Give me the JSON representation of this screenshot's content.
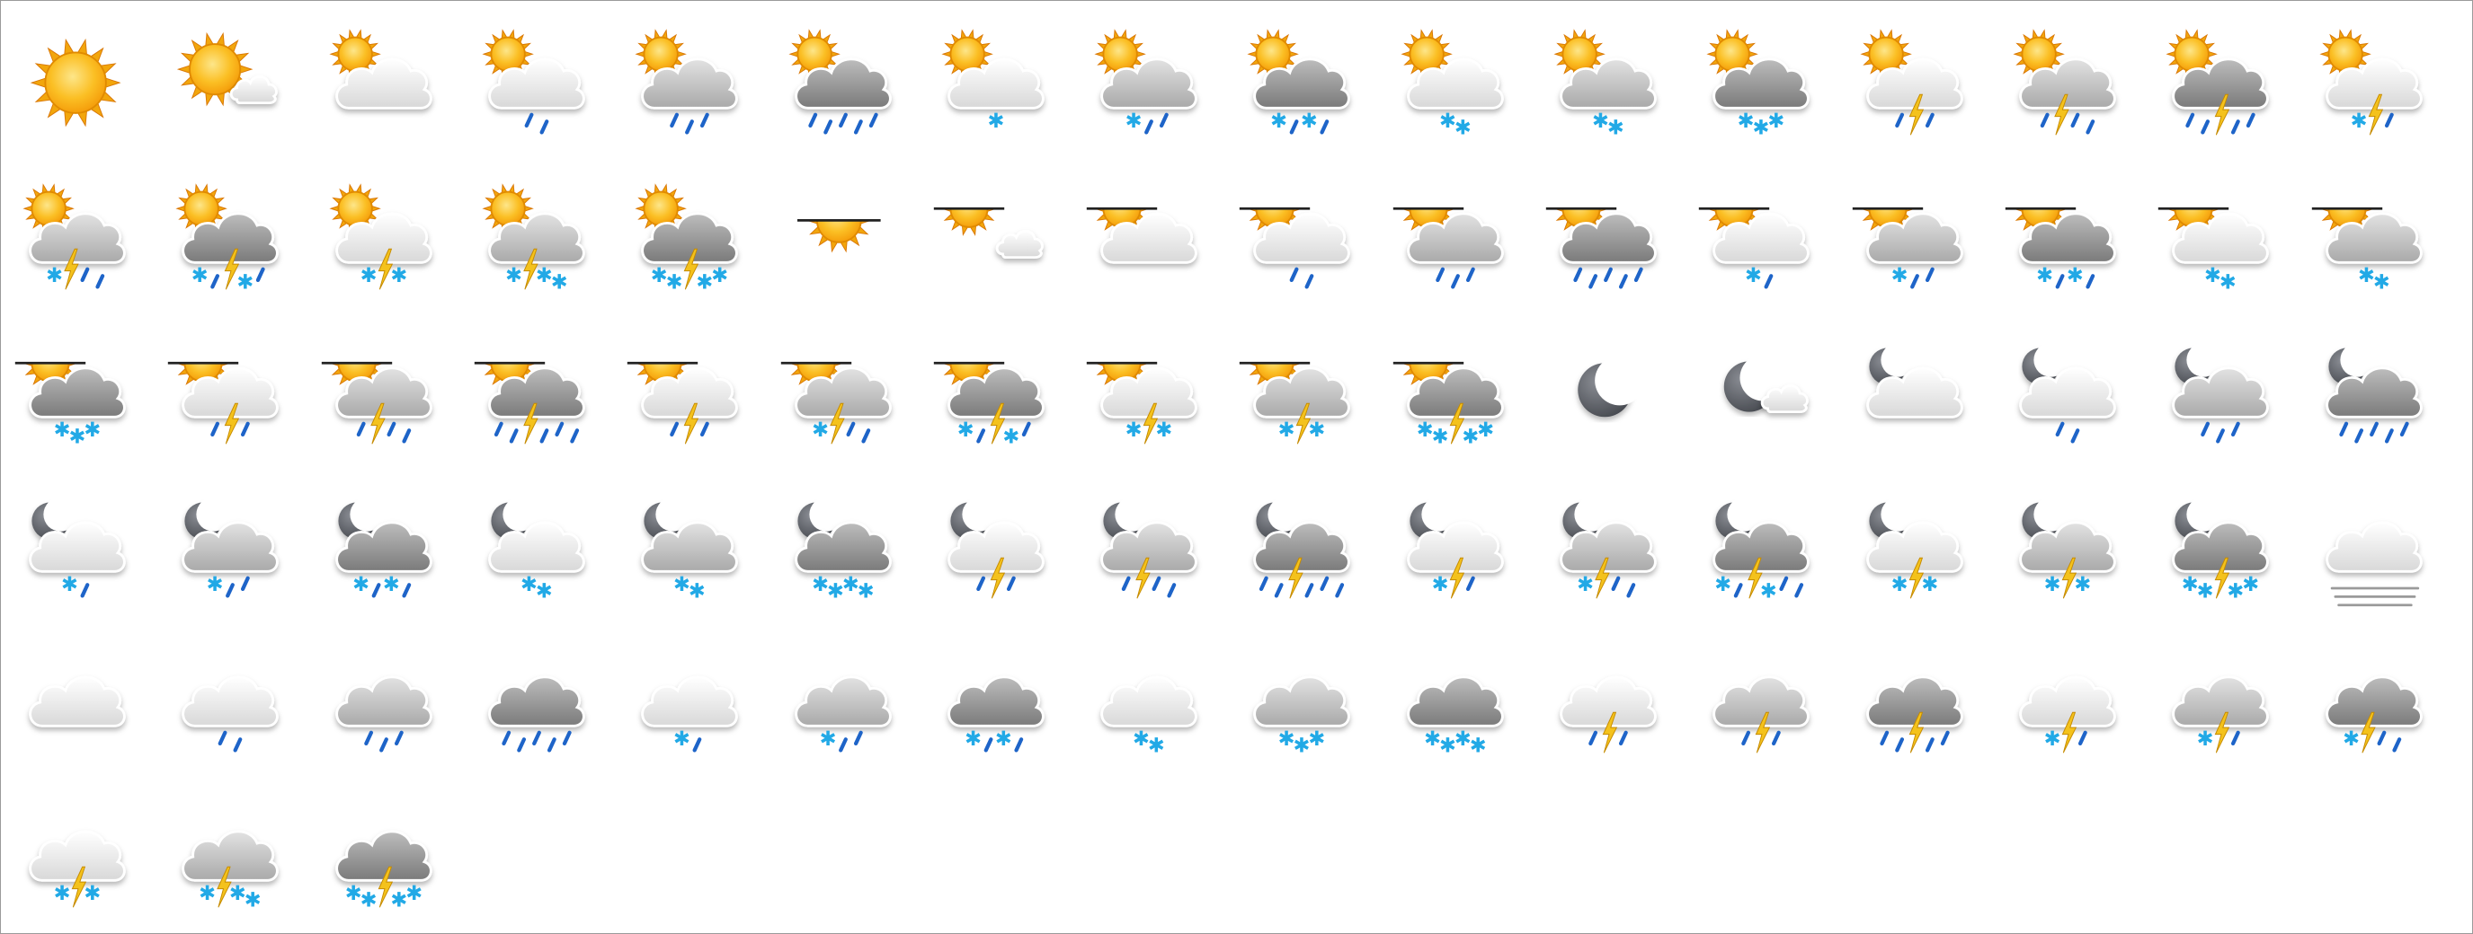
{
  "colors": {
    "sun_outer": "#f2a60c",
    "sun_inner": "#fcd34d",
    "moon": "#5e6168",
    "cloud_light": "#f3f3f3",
    "cloud_mid": "#cfcfcf",
    "cloud_dark": "#9c9c9c",
    "rain": "#1e64c8",
    "snow": "#22a9e6",
    "lightning": "#f4c21c",
    "horizon": "#222222",
    "fog": "#9a9a9a"
  },
  "icons": [
    {
      "name": "clear-sun-icon",
      "sky": "sun"
    },
    {
      "name": "sun-light-cloud-icon",
      "sky": "sun",
      "cloud": "small"
    },
    {
      "name": "sun-cloudy-icon",
      "sky": "sun",
      "cloud": "light"
    },
    {
      "name": "sun-light-rain-icon",
      "sky": "sun",
      "cloud": "light",
      "rain": 2
    },
    {
      "name": "sun-rain-icon",
      "sky": "sun",
      "cloud": "mid",
      "rain": 3
    },
    {
      "name": "sun-heavy-rain-icon",
      "sky": "sun",
      "cloud": "dark",
      "rain": 5
    },
    {
      "name": "sun-light-sleet-icon",
      "sky": "sun",
      "cloud": "light",
      "snow": 1
    },
    {
      "name": "sun-sleet-icon",
      "sky": "sun",
      "cloud": "mid",
      "snow": 1,
      "rain": 2
    },
    {
      "name": "sun-heavy-sleet-icon",
      "sky": "sun",
      "cloud": "dark",
      "snow": 2,
      "rain": 2
    },
    {
      "name": "sun-light-snow-icon",
      "sky": "sun",
      "cloud": "light",
      "snow": 2
    },
    {
      "name": "sun-snow-icon",
      "sky": "sun",
      "cloud": "mid",
      "snow": 2
    },
    {
      "name": "sun-heavy-snow-icon",
      "sky": "sun",
      "cloud": "dark",
      "snow": 3
    },
    {
      "name": "sun-light-rain-thunder-icon",
      "sky": "sun",
      "cloud": "light",
      "rain": 2,
      "bolt": true
    },
    {
      "name": "sun-rain-thunder-icon",
      "sky": "sun",
      "cloud": "mid",
      "rain": 3,
      "bolt": true
    },
    {
      "name": "sun-heavy-rain-thunder-icon",
      "sky": "sun",
      "cloud": "dark",
      "rain": 4,
      "bolt": true
    },
    {
      "name": "sun-light-sleet-thunder-icon",
      "sky": "sun",
      "cloud": "light",
      "snow": 1,
      "rain": 1,
      "bolt": true
    },
    {
      "name": "sun-sleet-thunder-icon",
      "sky": "sun",
      "cloud": "mid",
      "snow": 1,
      "rain": 2,
      "bolt": true
    },
    {
      "name": "sun-heavy-sleet-thunder-icon",
      "sky": "sun",
      "cloud": "dark",
      "snow": 2,
      "rain": 2,
      "bolt": true
    },
    {
      "name": "sun-light-snow-thunder-icon",
      "sky": "sun",
      "cloud": "light",
      "snow": 2,
      "bolt": true
    },
    {
      "name": "sun-snow-thunder-icon",
      "sky": "sun",
      "cloud": "mid",
      "snow": 3,
      "bolt": true
    },
    {
      "name": "sun-heavy-snow-thunder-icon",
      "sky": "sun",
      "cloud": "dark",
      "snow": 4,
      "bolt": true
    },
    {
      "name": "polar-sun-icon",
      "sky": "polar"
    },
    {
      "name": "polar-sun-light-cloud-icon",
      "sky": "polar",
      "cloud": "small"
    },
    {
      "name": "polar-cloudy-icon",
      "sky": "polar",
      "cloud": "light"
    },
    {
      "name": "polar-light-rain-icon",
      "sky": "polar",
      "cloud": "light",
      "rain": 2
    },
    {
      "name": "polar-rain-icon",
      "sky": "polar",
      "cloud": "mid",
      "rain": 3
    },
    {
      "name": "polar-heavy-rain-icon",
      "sky": "polar",
      "cloud": "dark",
      "rain": 5
    },
    {
      "name": "polar-light-sleet-icon",
      "sky": "polar",
      "cloud": "light",
      "snow": 1,
      "rain": 1
    },
    {
      "name": "polar-sleet-icon",
      "sky": "polar",
      "cloud": "mid",
      "snow": 1,
      "rain": 2
    },
    {
      "name": "polar-heavy-sleet-icon",
      "sky": "polar",
      "cloud": "dark",
      "snow": 2,
      "rain": 2
    },
    {
      "name": "polar-light-snow-icon",
      "sky": "polar",
      "cloud": "light",
      "snow": 2
    },
    {
      "name": "polar-snow-icon",
      "sky": "polar",
      "cloud": "mid",
      "snow": 2
    },
    {
      "name": "polar-heavy-snow-icon",
      "sky": "polar",
      "cloud": "dark",
      "snow": 3
    },
    {
      "name": "polar-light-rain-thunder-icon",
      "sky": "polar",
      "cloud": "light",
      "rain": 2,
      "bolt": true
    },
    {
      "name": "polar-rain-thunder-icon",
      "sky": "polar",
      "cloud": "mid",
      "rain": 3,
      "bolt": true
    },
    {
      "name": "polar-heavy-rain-thunder-icon",
      "sky": "polar",
      "cloud": "dark",
      "rain": 5,
      "bolt": true
    },
    {
      "name": "polar-light-sleet-thunder-icon",
      "sky": "polar",
      "cloud": "light",
      "rain": 2,
      "bolt": true
    },
    {
      "name": "polar-sleet-thunder-icon",
      "sky": "polar",
      "cloud": "mid",
      "snow": 1,
      "rain": 2,
      "bolt": true
    },
    {
      "name": "polar-heavy-sleet-thunder-icon",
      "sky": "polar",
      "cloud": "dark",
      "snow": 2,
      "rain": 2,
      "bolt": true
    },
    {
      "name": "polar-light-snow-thunder-icon",
      "sky": "polar",
      "cloud": "light",
      "snow": 2,
      "bolt": true
    },
    {
      "name": "polar-snow-thunder-icon",
      "sky": "polar",
      "cloud": "mid",
      "snow": 2,
      "bolt": true
    },
    {
      "name": "polar-heavy-snow-thunder-icon",
      "sky": "polar",
      "cloud": "dark",
      "snow": 4,
      "bolt": true
    },
    {
      "name": "clear-night-moon-icon",
      "sky": "moon"
    },
    {
      "name": "moon-light-cloud-icon",
      "sky": "moon",
      "cloud": "small"
    },
    {
      "name": "moon-cloudy-icon",
      "sky": "moon",
      "cloud": "light"
    },
    {
      "name": "moon-light-rain-icon",
      "sky": "moon",
      "cloud": "light",
      "rain": 2
    },
    {
      "name": "moon-rain-icon",
      "sky": "moon",
      "cloud": "mid",
      "rain": 3
    },
    {
      "name": "moon-heavy-rain-icon",
      "sky": "moon",
      "cloud": "dark",
      "rain": 5
    },
    {
      "name": "moon-light-sleet-icon",
      "sky": "moon",
      "cloud": "light",
      "snow": 1,
      "rain": 1
    },
    {
      "name": "moon-sleet-icon",
      "sky": "moon",
      "cloud": "mid",
      "snow": 1,
      "rain": 2
    },
    {
      "name": "moon-heavy-sleet-icon",
      "sky": "moon",
      "cloud": "dark",
      "snow": 2,
      "rain": 2
    },
    {
      "name": "moon-light-snow-icon",
      "sky": "moon",
      "cloud": "light",
      "snow": 2
    },
    {
      "name": "moon-snow-icon",
      "sky": "moon",
      "cloud": "mid",
      "snow": 2
    },
    {
      "name": "moon-heavy-snow-icon",
      "sky": "moon",
      "cloud": "dark",
      "snow": 4
    },
    {
      "name": "moon-light-rain-thunder-icon",
      "sky": "moon",
      "cloud": "light",
      "rain": 2,
      "bolt": true
    },
    {
      "name": "moon-rain-thunder-icon",
      "sky": "moon",
      "cloud": "mid",
      "rain": 3,
      "bolt": true
    },
    {
      "name": "moon-heavy-rain-thunder-icon",
      "sky": "moon",
      "cloud": "dark",
      "rain": 5,
      "bolt": true
    },
    {
      "name": "moon-light-sleet-thunder-icon",
      "sky": "moon",
      "cloud": "light",
      "snow": 1,
      "rain": 1,
      "bolt": true
    },
    {
      "name": "moon-sleet-thunder-icon",
      "sky": "moon",
      "cloud": "mid",
      "snow": 1,
      "rain": 2,
      "bolt": true
    },
    {
      "name": "moon-heavy-sleet-thunder-icon",
      "sky": "moon",
      "cloud": "dark",
      "snow": 2,
      "rain": 3,
      "bolt": true
    },
    {
      "name": "moon-light-snow-thunder-icon",
      "sky": "moon",
      "cloud": "light",
      "snow": 2,
      "bolt": true
    },
    {
      "name": "moon-snow-thunder-icon",
      "sky": "moon",
      "cloud": "mid",
      "snow": 2,
      "bolt": true
    },
    {
      "name": "moon-heavy-snow-thunder-icon",
      "sky": "moon",
      "cloud": "dark",
      "snow": 4,
      "bolt": true
    },
    {
      "name": "fog-icon",
      "cloud": "light",
      "fog": true
    },
    {
      "name": "cloudy-icon",
      "cloud": "light"
    },
    {
      "name": "light-rain-icon",
      "cloud": "light",
      "rain": 2
    },
    {
      "name": "rain-icon",
      "cloud": "mid",
      "rain": 3
    },
    {
      "name": "heavy-rain-icon",
      "cloud": "dark",
      "rain": 5
    },
    {
      "name": "light-sleet-icon",
      "cloud": "light",
      "snow": 1,
      "rain": 1
    },
    {
      "name": "sleet-icon",
      "cloud": "mid",
      "snow": 1,
      "rain": 2
    },
    {
      "name": "heavy-sleet-icon",
      "cloud": "dark",
      "snow": 2,
      "rain": 2
    },
    {
      "name": "light-snow-icon",
      "cloud": "light",
      "snow": 2
    },
    {
      "name": "snow-icon",
      "cloud": "mid",
      "snow": 3
    },
    {
      "name": "heavy-snow-icon",
      "cloud": "dark",
      "snow": 4
    },
    {
      "name": "light-rain-thunder-icon",
      "cloud": "light",
      "rain": 2,
      "bolt": true
    },
    {
      "name": "rain-thunder-icon",
      "cloud": "mid",
      "rain": 2,
      "bolt": true
    },
    {
      "name": "heavy-rain-thunder-icon",
      "cloud": "dark",
      "rain": 4,
      "bolt": true
    },
    {
      "name": "light-sleet-thunder-icon",
      "cloud": "light",
      "snow": 1,
      "rain": 1,
      "bolt": true
    },
    {
      "name": "sleet-thunder-icon",
      "cloud": "mid",
      "snow": 1,
      "rain": 1,
      "bolt": true
    },
    {
      "name": "heavy-sleet-thunder-icon",
      "cloud": "dark",
      "snow": 1,
      "rain": 2,
      "bolt": true
    },
    {
      "name": "light-snow-thunder-icon",
      "cloud": "light",
      "snow": 2,
      "bolt": true
    },
    {
      "name": "snow-thunder-icon",
      "cloud": "mid",
      "snow": 3,
      "bolt": true
    },
    {
      "name": "heavy-snow-thunder-icon",
      "cloud": "dark",
      "snow": 4,
      "bolt": true
    }
  ]
}
